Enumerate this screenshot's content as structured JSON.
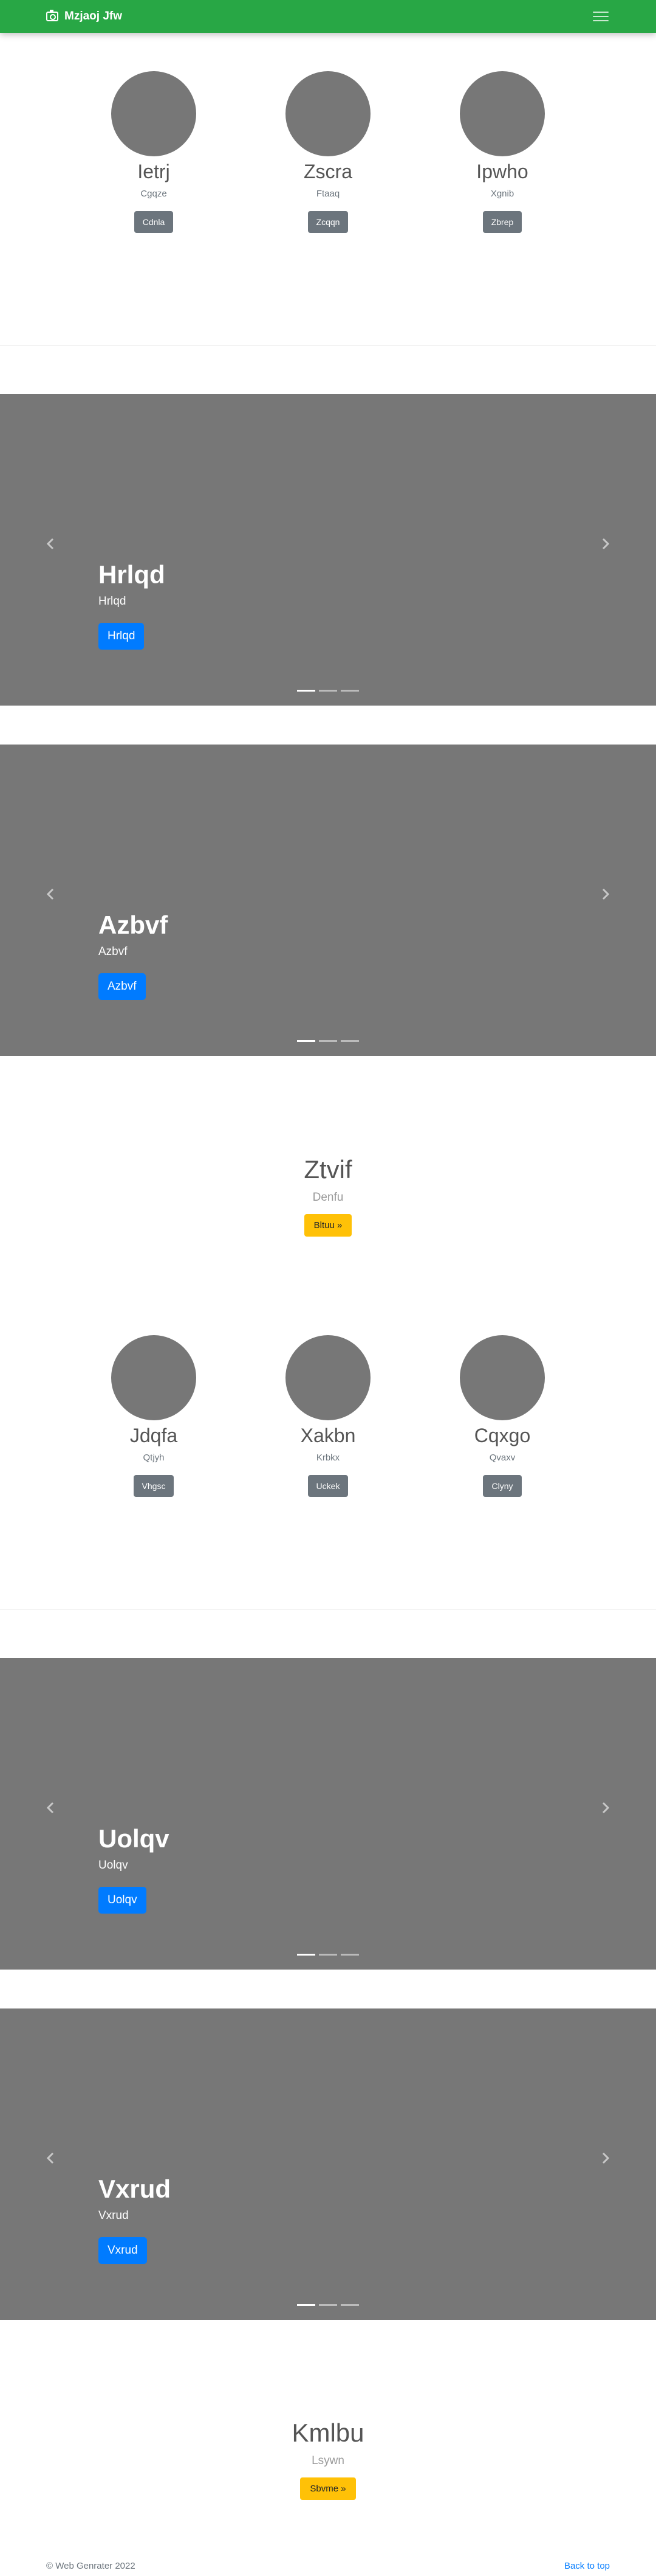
{
  "navbar": {
    "brand": "Mzjaoj Jfw",
    "brand_icon": "camera-icon",
    "toggler_icon": "hamburger-menu-icon",
    "color": "#28a745"
  },
  "team1": [
    {
      "name": "Ietrj",
      "role": "Cgqze",
      "button": "Cdnla"
    },
    {
      "name": "Zscra",
      "role": "Ftaaq",
      "button": "Zcqqn"
    },
    {
      "name": "Ipwho",
      "role": "Xgnib",
      "button": "Zbrep"
    }
  ],
  "carousel1": {
    "title": "Hrlqd",
    "text": "Hrlqd",
    "button": "Hrlqd",
    "slides": 3,
    "active": 0
  },
  "carousel2": {
    "title": "Azbvf",
    "text": "Azbvf",
    "button": "Azbvf",
    "slides": 3,
    "active": 0
  },
  "feature1": {
    "title": "Ztvif",
    "text": "Denfu",
    "button": "Bltuu »"
  },
  "team2": [
    {
      "name": "Jdqfa",
      "role": "Qtjyh",
      "button": "Vhgsc"
    },
    {
      "name": "Xakbn",
      "role": "Krbkx",
      "button": "Uckek"
    },
    {
      "name": "Cqxgo",
      "role": "Qvaxv",
      "button": "Clyny"
    }
  ],
  "carousel3": {
    "title": "Uolqv",
    "text": "Uolqv",
    "button": "Uolqv",
    "slides": 3,
    "active": 0
  },
  "carousel4": {
    "title": "Vxrud",
    "text": "Vxrud",
    "button": "Vxrud",
    "slides": 3,
    "active": 0
  },
  "feature2": {
    "title": "Kmlbu",
    "text": "Lsywn",
    "button": "Sbvme »"
  },
  "footer": {
    "copyright": "© Web Genrater 2022",
    "back_to_top": "Back to top"
  },
  "colors": {
    "primary": "#007bff",
    "secondary": "#6c757d",
    "warning": "#ffc107",
    "placeholder": "#777777"
  }
}
